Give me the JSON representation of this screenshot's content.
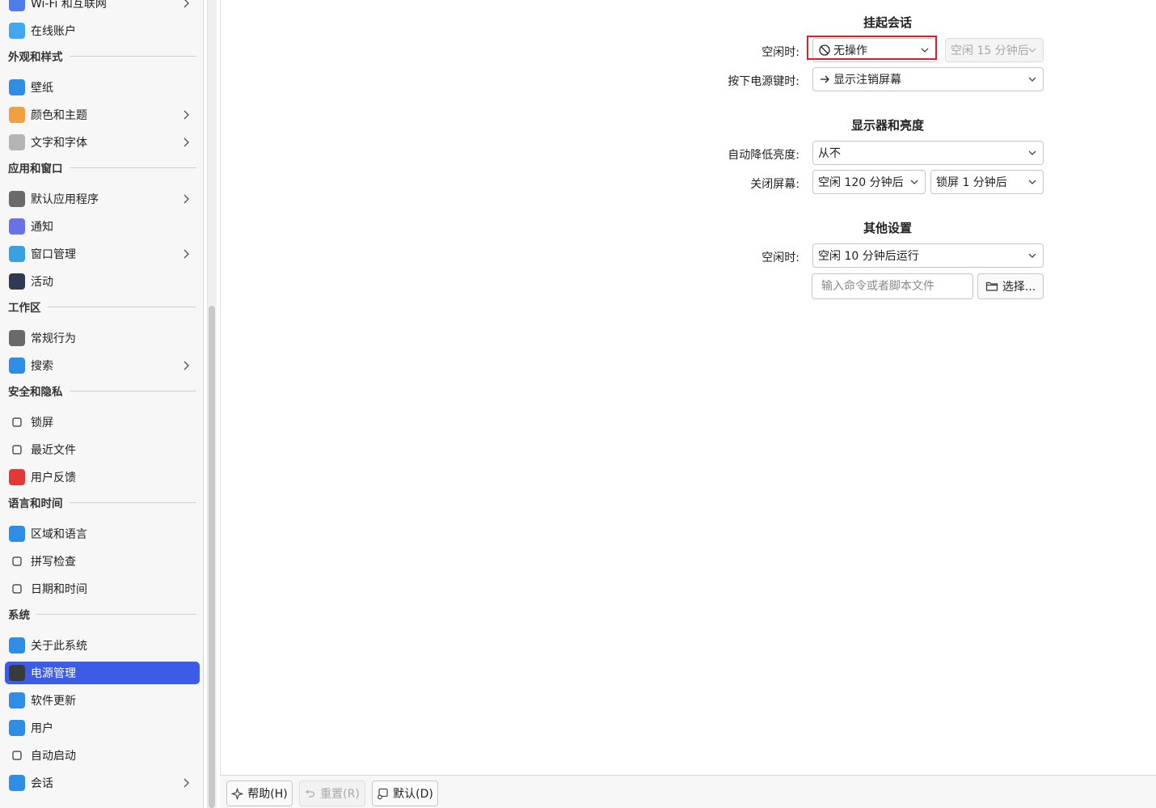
{
  "sidebar": {
    "items_top": [
      {
        "label": "Wi-Fi 和互联网",
        "icon": "wifi-icon",
        "color": "#4f7ce8",
        "chevron": true
      },
      {
        "label": "在线账户",
        "icon": "cloud-icon",
        "color": "#43a7f0",
        "chevron": false
      }
    ],
    "sections": [
      {
        "title": "外观和样式",
        "items": [
          {
            "label": "壁纸",
            "icon": "wallpaper-icon",
            "color": "#2f8de4",
            "chevron": false
          },
          {
            "label": "颜色和主题",
            "icon": "palette-icon",
            "color": "#f0a040",
            "chevron": true
          },
          {
            "label": "文字和字体",
            "icon": "font-icon",
            "color": "#b5b5b5",
            "chevron": true
          }
        ]
      },
      {
        "title": "应用和窗口",
        "items": [
          {
            "label": "默认应用程序",
            "icon": "default-apps-icon",
            "color": "#6a6a6a",
            "chevron": true
          },
          {
            "label": "通知",
            "icon": "notification-icon",
            "color": "#6a72e8",
            "chevron": false
          },
          {
            "label": "窗口管理",
            "icon": "window-icon",
            "color": "#3aa0e0",
            "chevron": true
          },
          {
            "label": "活动",
            "icon": "activity-icon",
            "color": "#2d3a52",
            "chevron": false
          }
        ]
      },
      {
        "title": "工作区",
        "items": [
          {
            "label": "常规行为",
            "icon": "general-behavior-icon",
            "color": "#6a6a6a",
            "chevron": false
          },
          {
            "label": "搜索",
            "icon": "search-icon",
            "color": "#2f8de4",
            "chevron": true
          }
        ]
      },
      {
        "title": "安全和隐私",
        "items": [
          {
            "label": "锁屏",
            "icon": "lock-icon",
            "color": "transparent",
            "chevron": false
          },
          {
            "label": "最近文件",
            "icon": "recent-files-icon",
            "color": "transparent",
            "chevron": false
          },
          {
            "label": "用户反馈",
            "icon": "feedback-icon",
            "color": "#e23838",
            "chevron": false
          }
        ]
      },
      {
        "title": "语言和时间",
        "items": [
          {
            "label": "区域和语言",
            "icon": "globe-icon",
            "color": "#2f8de4",
            "chevron": false
          },
          {
            "label": "拼写检查",
            "icon": "spellcheck-icon",
            "color": "transparent",
            "chevron": false
          },
          {
            "label": "日期和时间",
            "icon": "clock-icon",
            "color": "transparent",
            "chevron": false
          }
        ]
      },
      {
        "title": "系统",
        "items": [
          {
            "label": "关于此系统",
            "icon": "info-icon",
            "color": "#2f8de4",
            "chevron": false
          },
          {
            "label": "电源管理",
            "icon": "battery-icon",
            "color": "#3a3a3a",
            "chevron": false,
            "active": true
          },
          {
            "label": "软件更新",
            "icon": "update-icon",
            "color": "#2f8de4",
            "chevron": false
          },
          {
            "label": "用户",
            "icon": "user-icon",
            "color": "#2f8de4",
            "chevron": false
          },
          {
            "label": "自动启动",
            "icon": "autostart-icon",
            "color": "transparent",
            "chevron": false
          },
          {
            "label": "会话",
            "icon": "session-icon",
            "color": "#2f8de4",
            "chevron": true
          }
        ]
      }
    ]
  },
  "main": {
    "suspend": {
      "title": "挂起会话",
      "idle_label": "空闲时:",
      "idle_value": "无操作",
      "idle_delay": "空闲 15 分钟后",
      "power_key_label": "按下电源键时:",
      "power_key_value": "显示注销屏幕"
    },
    "display": {
      "title": "显示器和亮度",
      "dim_label": "自动降低亮度:",
      "dim_value": "从不",
      "off_label": "关闭屏幕:",
      "off_value": "空闲 120 分钟后",
      "lock_value": "锁屏 1 分钟后"
    },
    "other": {
      "title": "其他设置",
      "idle_label": "空闲时:",
      "idle_value": "空闲 10 分钟后运行",
      "command_placeholder": "输入命令或者脚本文件",
      "choose_label": "选择..."
    }
  },
  "footer": {
    "help_label": "帮助(H)",
    "reset_label": "重置(R)",
    "defaults_label": "默认(D)"
  },
  "colors": {
    "accent": "#3d5ce6",
    "highlight": "#d6202a"
  }
}
